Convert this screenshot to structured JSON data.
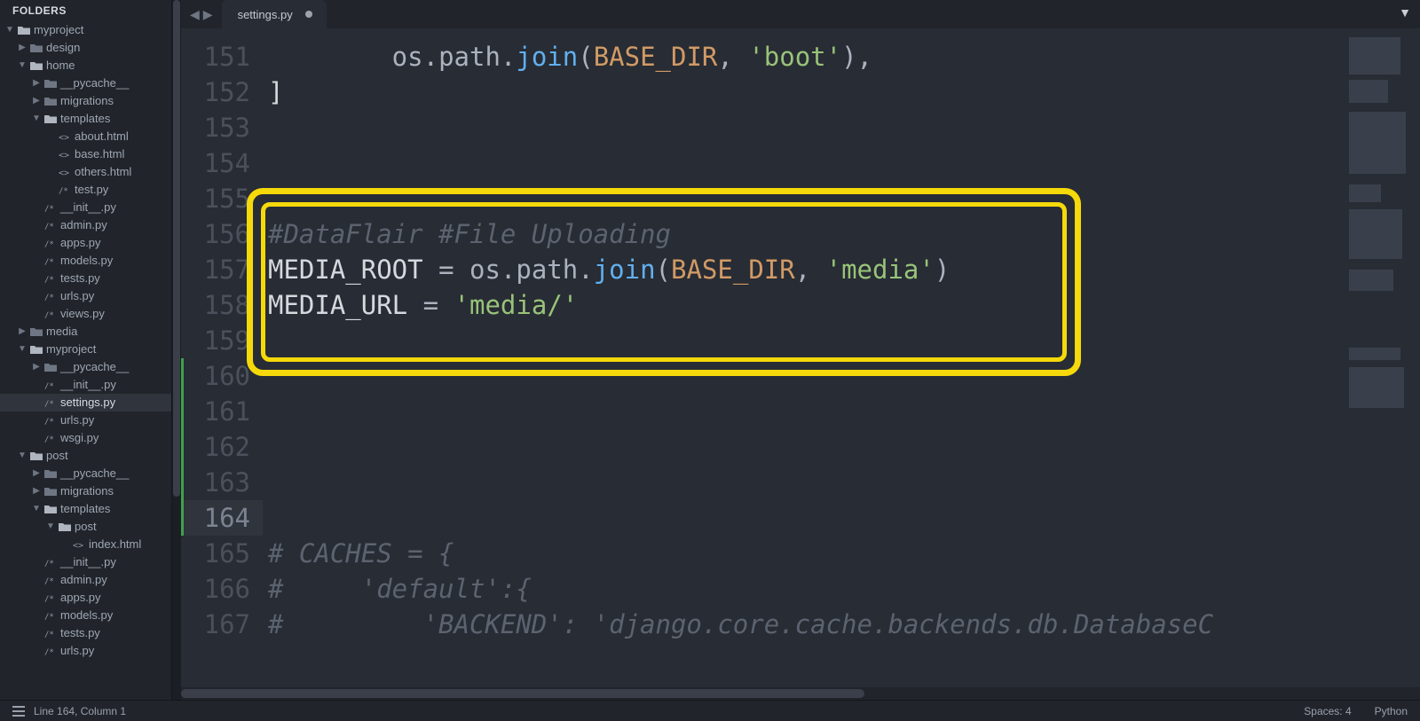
{
  "sidebar": {
    "header": "FOLDERS",
    "tree": [
      {
        "depth": 0,
        "kind": "folder-open",
        "disclosure": "down",
        "label": "myproject"
      },
      {
        "depth": 1,
        "kind": "folder",
        "disclosure": "right",
        "label": "design"
      },
      {
        "depth": 1,
        "kind": "folder-open",
        "disclosure": "down",
        "label": "home"
      },
      {
        "depth": 2,
        "kind": "folder",
        "disclosure": "right",
        "label": "__pycache__"
      },
      {
        "depth": 2,
        "kind": "folder",
        "disclosure": "right",
        "label": "migrations"
      },
      {
        "depth": 2,
        "kind": "folder-open",
        "disclosure": "down",
        "label": "templates"
      },
      {
        "depth": 3,
        "kind": "html",
        "disclosure": "",
        "label": "about.html"
      },
      {
        "depth": 3,
        "kind": "html",
        "disclosure": "",
        "label": "base.html"
      },
      {
        "depth": 3,
        "kind": "html",
        "disclosure": "",
        "label": "others.html"
      },
      {
        "depth": 3,
        "kind": "py",
        "disclosure": "",
        "label": "test.py"
      },
      {
        "depth": 2,
        "kind": "py",
        "disclosure": "",
        "label": "__init__.py"
      },
      {
        "depth": 2,
        "kind": "py",
        "disclosure": "",
        "label": "admin.py"
      },
      {
        "depth": 2,
        "kind": "py",
        "disclosure": "",
        "label": "apps.py"
      },
      {
        "depth": 2,
        "kind": "py",
        "disclosure": "",
        "label": "models.py"
      },
      {
        "depth": 2,
        "kind": "py",
        "disclosure": "",
        "label": "tests.py"
      },
      {
        "depth": 2,
        "kind": "py",
        "disclosure": "",
        "label": "urls.py"
      },
      {
        "depth": 2,
        "kind": "py",
        "disclosure": "",
        "label": "views.py"
      },
      {
        "depth": 1,
        "kind": "folder",
        "disclosure": "right",
        "label": "media"
      },
      {
        "depth": 1,
        "kind": "folder-open",
        "disclosure": "down",
        "label": "myproject"
      },
      {
        "depth": 2,
        "kind": "folder",
        "disclosure": "right",
        "label": "__pycache__"
      },
      {
        "depth": 2,
        "kind": "py",
        "disclosure": "",
        "label": "__init__.py"
      },
      {
        "depth": 2,
        "kind": "py",
        "disclosure": "",
        "label": "settings.py",
        "selected": true
      },
      {
        "depth": 2,
        "kind": "py",
        "disclosure": "",
        "label": "urls.py"
      },
      {
        "depth": 2,
        "kind": "py",
        "disclosure": "",
        "label": "wsgi.py"
      },
      {
        "depth": 1,
        "kind": "folder-open",
        "disclosure": "down",
        "label": "post"
      },
      {
        "depth": 2,
        "kind": "folder",
        "disclosure": "right",
        "label": "__pycache__"
      },
      {
        "depth": 2,
        "kind": "folder",
        "disclosure": "right",
        "label": "migrations"
      },
      {
        "depth": 2,
        "kind": "folder-open",
        "disclosure": "down",
        "label": "templates"
      },
      {
        "depth": 3,
        "kind": "folder-open",
        "disclosure": "down",
        "label": "post"
      },
      {
        "depth": 4,
        "kind": "html",
        "disclosure": "",
        "label": "index.html"
      },
      {
        "depth": 2,
        "kind": "py",
        "disclosure": "",
        "label": "__init__.py"
      },
      {
        "depth": 2,
        "kind": "py",
        "disclosure": "",
        "label": "admin.py"
      },
      {
        "depth": 2,
        "kind": "py",
        "disclosure": "",
        "label": "apps.py"
      },
      {
        "depth": 2,
        "kind": "py",
        "disclosure": "",
        "label": "models.py"
      },
      {
        "depth": 2,
        "kind": "py",
        "disclosure": "",
        "label": "tests.py"
      },
      {
        "depth": 2,
        "kind": "py",
        "disclosure": "",
        "label": "urls.py"
      }
    ]
  },
  "tabs": {
    "active": {
      "title": "settings.py",
      "dirty": true
    }
  },
  "editor": {
    "line_numbers": [
      151,
      152,
      153,
      154,
      155,
      156,
      157,
      158,
      159,
      160,
      161,
      162,
      163,
      164,
      165,
      166,
      167
    ],
    "current_line_number": 164,
    "modified_ranges": [
      [
        160,
        164
      ]
    ],
    "lines": {
      "151": [
        {
          "t": "        os",
          "c": "id"
        },
        {
          "t": ".",
          "c": "op"
        },
        {
          "t": "path",
          "c": "id"
        },
        {
          "t": ".",
          "c": "op"
        },
        {
          "t": "join",
          "c": "fn"
        },
        {
          "t": "(",
          "c": "op"
        },
        {
          "t": "BASE_DIR",
          "c": "const"
        },
        {
          "t": ", ",
          "c": "op"
        },
        {
          "t": "'boot'",
          "c": "str"
        },
        {
          "t": "),",
          "c": "op"
        }
      ],
      "152": [
        {
          "t": "]",
          "c": "white"
        }
      ],
      "153": [
        {
          "t": "",
          "c": "id"
        }
      ],
      "154": [
        {
          "t": "",
          "c": "id"
        }
      ],
      "155": [
        {
          "t": "",
          "c": "id"
        }
      ],
      "156": [
        {
          "t": "#DataFlair #File Uploading",
          "c": "com"
        }
      ],
      "157": [
        {
          "t": "MEDIA_ROOT ",
          "c": "white"
        },
        {
          "t": "=",
          "c": "op"
        },
        {
          "t": " os",
          "c": "id"
        },
        {
          "t": ".",
          "c": "op"
        },
        {
          "t": "path",
          "c": "id"
        },
        {
          "t": ".",
          "c": "op"
        },
        {
          "t": "join",
          "c": "fn"
        },
        {
          "t": "(",
          "c": "op"
        },
        {
          "t": "BASE_DIR",
          "c": "const"
        },
        {
          "t": ", ",
          "c": "op"
        },
        {
          "t": "'media'",
          "c": "str"
        },
        {
          "t": ")",
          "c": "op"
        }
      ],
      "158": [
        {
          "t": "MEDIA_URL ",
          "c": "white"
        },
        {
          "t": "=",
          "c": "op"
        },
        {
          "t": " ",
          "c": "op"
        },
        {
          "t": "'media/'",
          "c": "str"
        }
      ],
      "159": [
        {
          "t": "",
          "c": "id"
        }
      ],
      "160": [
        {
          "t": "",
          "c": "id"
        }
      ],
      "161": [
        {
          "t": "",
          "c": "id"
        }
      ],
      "162": [
        {
          "t": "",
          "c": "id"
        }
      ],
      "163": [
        {
          "t": "",
          "c": "id"
        }
      ],
      "164": [
        {
          "t": "",
          "c": "id"
        }
      ],
      "165": [
        {
          "t": "# CACHES = {",
          "c": "com"
        }
      ],
      "166": [
        {
          "t": "#     'default':{",
          "c": "com"
        }
      ],
      "167": [
        {
          "t": "#         'BACKEND': 'django.core.cache.backends.db.DatabaseC",
          "c": "com"
        }
      ]
    },
    "highlight": {
      "top_line": 155,
      "bottom_line": 159
    }
  },
  "statusbar": {
    "cursor": "Line 164, Column 1",
    "spaces": "Spaces: 4",
    "syntax": "Python"
  }
}
